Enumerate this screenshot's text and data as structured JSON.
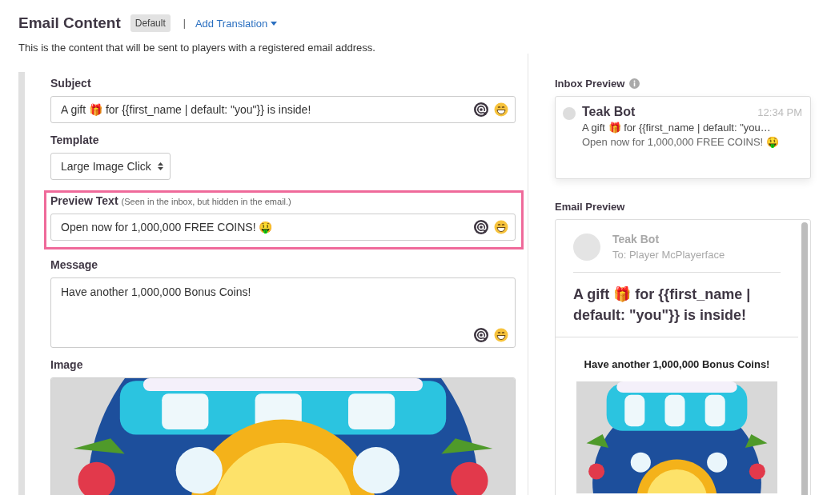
{
  "header": {
    "title": "Email Content",
    "badge": "Default",
    "separator": "|",
    "link": "Add Translation",
    "description": "This is the content that will be sent to players with a registered email address."
  },
  "form": {
    "fields": [
      {
        "kind": "text",
        "label": "Subject",
        "value": "A gift 🎁 for {{first_name | default: \"you\"}} is inside!",
        "highlighted": false
      },
      {
        "kind": "select",
        "label": "Template",
        "value": "Large Image Click"
      },
      {
        "kind": "text",
        "label": "Preview Text",
        "hint": "(Seen in the inbox, but hidden in the email.)",
        "value": "Open now for 1,000,000 FREE COINS! 🤑",
        "highlighted": true
      },
      {
        "kind": "textarea",
        "label": "Message",
        "value": "Have another 1,000,000 Bonus Coins!"
      },
      {
        "label": "Image"
      }
    ]
  },
  "inbox_preview": {
    "title": "Inbox Preview",
    "sender": "Teak Bot",
    "time": "12:34 PM",
    "subject": "A gift 🎁 for {{first_name | default: \"you…",
    "preview": "Open now for 1,000,000 FREE COINS! 🤑"
  },
  "email_preview": {
    "title": "Email Preview",
    "sender": "Teak Bot",
    "to": "To: Player McPlayerface",
    "subject": "A gift 🎁 for {{first_name | default: \"you\"}} is inside!",
    "message": "Have another 1,000,000 Bonus Coins!"
  }
}
